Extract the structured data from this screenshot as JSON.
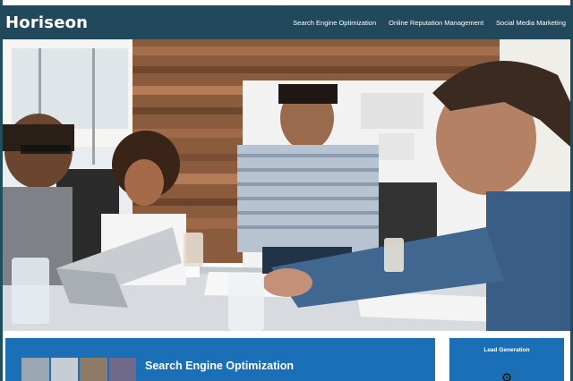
{
  "header": {
    "logo": "Horiseon",
    "nav": [
      {
        "label": "Search Engine Optimization"
      },
      {
        "label": "Online Reputation Management"
      },
      {
        "label": "Social Media Marketing"
      }
    ]
  },
  "hero": {
    "image_icon": "hero-image-icon",
    "description_colors": {
      "wall": "#8a5a3e",
      "table": "#d9dde2",
      "window": "#f3f1ec"
    }
  },
  "cards": {
    "seo": {
      "title": "Search Engine Optimization"
    },
    "lead": {
      "title": "Lead Generation",
      "icon": "gear-icon"
    }
  },
  "colors": {
    "header": "#21495b",
    "card": "#1a6fb6",
    "text": "#ffffff"
  }
}
